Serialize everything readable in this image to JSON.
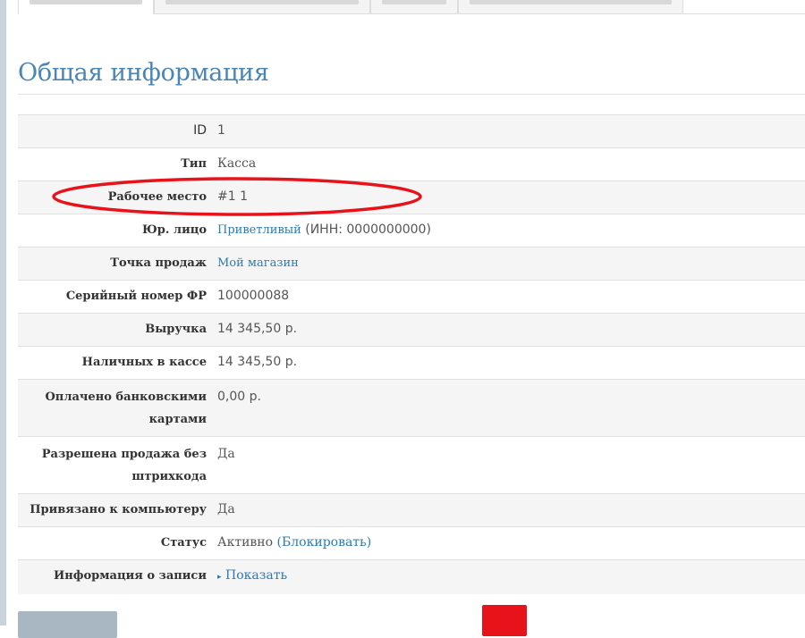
{
  "page": {
    "title": "Общая информация"
  },
  "colors": {
    "accent": "#4a86b5",
    "link": "#2a7bb6",
    "annotation": "#e8121b",
    "danger_button": "#e8121b"
  },
  "rows": {
    "id": {
      "label": "ID",
      "value": "1"
    },
    "type": {
      "label": "Тип",
      "value": "Касса"
    },
    "workplace": {
      "label": "Рабочее место",
      "value": "#1 1"
    },
    "legal": {
      "label": "Юр. лицо",
      "link": "Приветливый",
      "suffix": " (ИНН: 0000000000)"
    },
    "point": {
      "label": "Точка продаж",
      "link": "Мой магазин"
    },
    "serial": {
      "label": "Серийный номер ФР",
      "value": "100000088"
    },
    "revenue": {
      "label": "Выручка",
      "value": "14 345,50 р."
    },
    "cash": {
      "label": "Наличных в кассе",
      "value": "14 345,50 р."
    },
    "cards": {
      "label_line1": "Оплачено банковскими",
      "label_line2": "картами",
      "value": "0,00 р."
    },
    "barcode": {
      "label_line1": "Разрешена продажа без",
      "label_line2": "штрихкода",
      "value": "Да"
    },
    "computer": {
      "label": "Привязано к компьютеру",
      "value": "Да"
    },
    "status": {
      "label": "Статус",
      "value": "Активно",
      "open": " (",
      "link": "Блокировать",
      "close": ")"
    },
    "record": {
      "label": "Информация о записи",
      "caret": "▸",
      "link": "Показать"
    }
  },
  "icons": {
    "record_caret": "caret-right-icon"
  }
}
